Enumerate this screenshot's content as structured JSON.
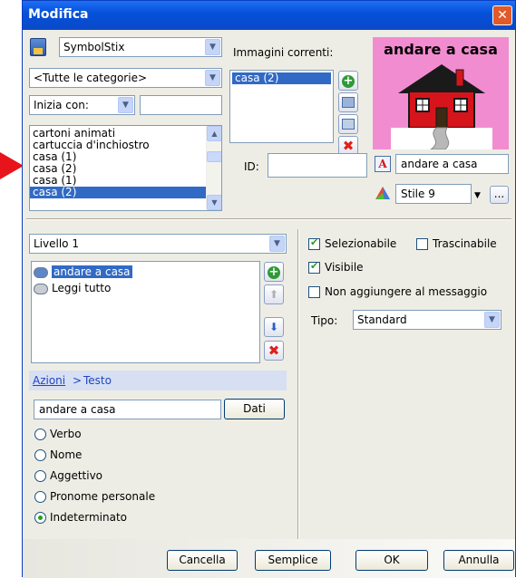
{
  "window": {
    "title": "Modifica"
  },
  "symbol_set": {
    "value": "SymbolStix"
  },
  "category": {
    "value": "<Tutte le categorie>"
  },
  "starts_with": {
    "value": "Inizia con:",
    "text": ""
  },
  "word_list": [
    "cartoni animati",
    "cartuccia d'inchiostro",
    "casa (1)",
    "casa  (2)",
    "casa (1)",
    "casa (2)"
  ],
  "word_list_selected": 5,
  "current_images": {
    "label": "Immagini correnti:",
    "items": [
      "casa (2)"
    ]
  },
  "preview": {
    "caption": "andare a casa",
    "bg_color": "#f28cd0"
  },
  "id_field": {
    "label": "ID:",
    "value": ""
  },
  "text_field": {
    "value": "andare a casa"
  },
  "style": {
    "value": "Stile 9",
    "more": "..."
  },
  "level": {
    "value": "Livello 1"
  },
  "actions": [
    "andare a casa",
    "Leggi tutto"
  ],
  "breadcrumb": {
    "link": "Azioni",
    "sep": ">",
    "current": "Testo"
  },
  "action_text": {
    "value": "andare a casa",
    "data_button": "Dati"
  },
  "word_types": [
    "Verbo",
    "Nome",
    "Aggettivo",
    "Pronome personale",
    "Indeterminato"
  ],
  "word_type_selected": 4,
  "options": {
    "selectable": "Selezionabile",
    "draggable": "Trascinabile",
    "visible": "Visibile",
    "no_add": "Non aggiungere al messaggio"
  },
  "type": {
    "label": "Tipo:",
    "value": "Standard"
  },
  "buttons": {
    "clear": "Cancella",
    "simple": "Semplice",
    "ok": "OK",
    "cancel": "Annulla"
  },
  "colors": {
    "title_bar": "#0552db",
    "selection": "#316ac5",
    "dialog_bg": "#eeede5",
    "arrow": "#e8141c"
  }
}
